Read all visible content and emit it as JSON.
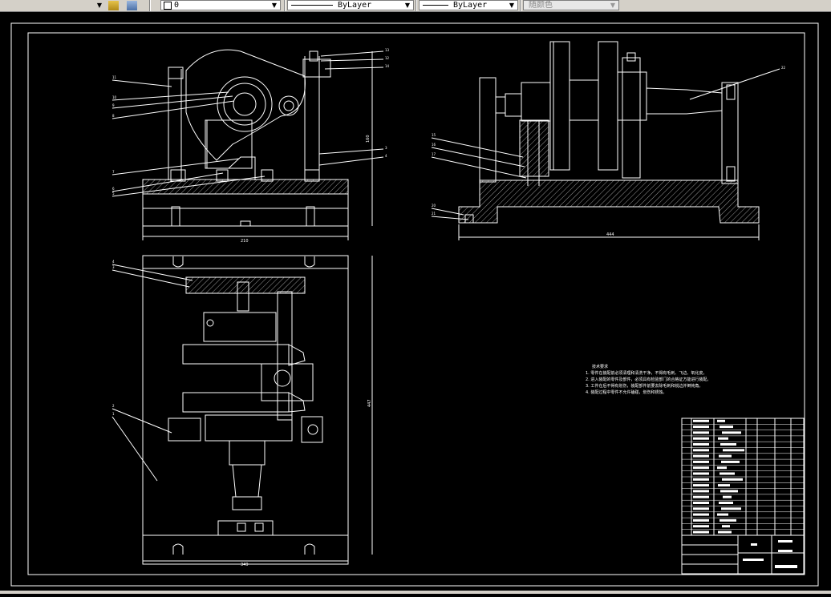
{
  "toolbar": {
    "layer_value": "0",
    "linetype_value": "ByLayer",
    "lineweight_value": "ByLayer",
    "color_value": "随颜色"
  },
  "drawing": {
    "tech_title": "技术要求",
    "tech_notes": [
      "1. 零件在装配前必须清理和清洗干净，不得有毛刺、飞边、氧化皮。",
      "2. 进入装配的零件及部件，必须具有检验部门的合格证方能进行装配。",
      "3. 工件在后不得有划伤，装配部件前要去除毛刺和锐边并倒钝角。",
      "4. 装配过程中零件不允许磕碰，划伤和锈蚀。"
    ],
    "dims": {
      "front_width": "210",
      "front_height": "160",
      "side_width": "444",
      "plan_width": "349",
      "plan_height": "447"
    }
  }
}
